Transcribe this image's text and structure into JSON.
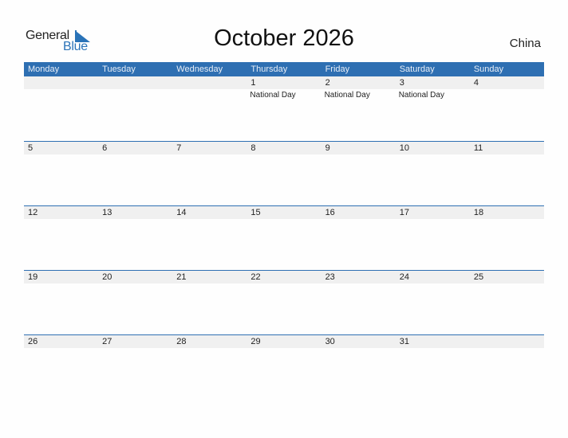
{
  "logo": {
    "word1": "General",
    "word2": "Blue"
  },
  "title": "October 2026",
  "country": "China",
  "colors": {
    "accent": "#2e6fb2",
    "band": "#f0f0f0"
  },
  "weekdays": [
    "Monday",
    "Tuesday",
    "Wednesday",
    "Thursday",
    "Friday",
    "Saturday",
    "Sunday"
  ],
  "weeks": [
    [
      {
        "day": ""
      },
      {
        "day": ""
      },
      {
        "day": ""
      },
      {
        "day": "1",
        "holiday": "National Day"
      },
      {
        "day": "2",
        "holiday": "National Day"
      },
      {
        "day": "3",
        "holiday": "National Day"
      },
      {
        "day": "4"
      }
    ],
    [
      {
        "day": "5"
      },
      {
        "day": "6"
      },
      {
        "day": "7"
      },
      {
        "day": "8"
      },
      {
        "day": "9"
      },
      {
        "day": "10"
      },
      {
        "day": "11"
      }
    ],
    [
      {
        "day": "12"
      },
      {
        "day": "13"
      },
      {
        "day": "14"
      },
      {
        "day": "15"
      },
      {
        "day": "16"
      },
      {
        "day": "17"
      },
      {
        "day": "18"
      }
    ],
    [
      {
        "day": "19"
      },
      {
        "day": "20"
      },
      {
        "day": "21"
      },
      {
        "day": "22"
      },
      {
        "day": "23"
      },
      {
        "day": "24"
      },
      {
        "day": "25"
      }
    ],
    [
      {
        "day": "26"
      },
      {
        "day": "27"
      },
      {
        "day": "28"
      },
      {
        "day": "29"
      },
      {
        "day": "30"
      },
      {
        "day": "31"
      },
      {
        "day": ""
      }
    ]
  ]
}
